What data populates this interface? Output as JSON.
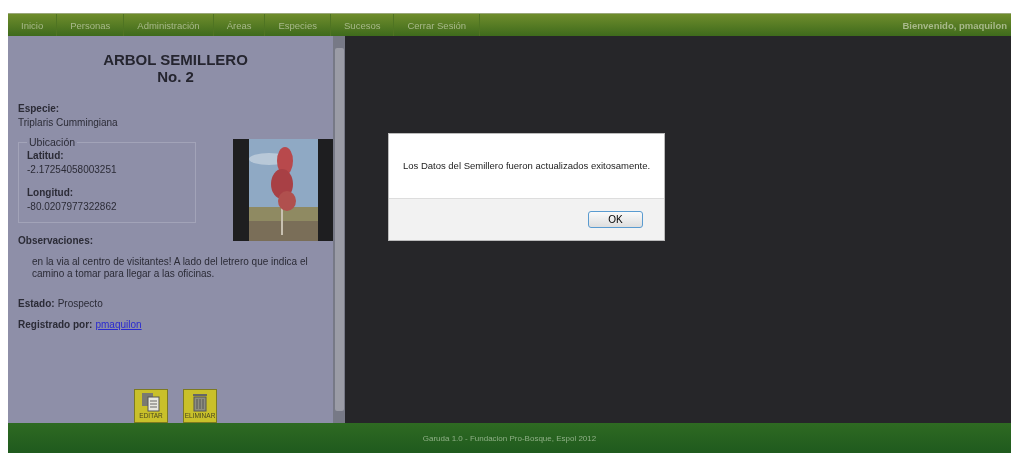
{
  "nav": {
    "items": [
      "Inicio",
      "Personas",
      "Administración",
      "Áreas",
      "Especies",
      "Sucesos",
      "Cerrar Sesión"
    ],
    "welcome": "Bienvenido, pmaquilon"
  },
  "record": {
    "title": "ARBOL SEMILLERO",
    "number": "No. 2",
    "species_label": "Especie:",
    "species": "Triplaris Cummingiana",
    "location": {
      "legend": "Ubicación",
      "lat_label": "Latitud:",
      "lat": "-2.17254058003251",
      "lon_label": "Longitud:",
      "lon": "-80.0207977322862"
    },
    "observations_label": "Observaciones:",
    "observations": "en la via al centro de visitantes! A lado del letrero que indica el camino a tomar para llegar a las oficinas.",
    "status_label": "Estado:",
    "status": "Prospecto",
    "registered_label": "Registrado por:",
    "registered_by": "pmaquilon",
    "actions": [
      {
        "kind": "edit",
        "label": "EDITAR"
      },
      {
        "kind": "delete",
        "label": "ELIMINAR"
      }
    ]
  },
  "dialog": {
    "message": "Los Datos del Semillero fueron actualizados exitosamente.",
    "button": "OK"
  },
  "footer": "Garuda 1.0 - Fundacion Pro-Bosque, Espol 2012"
}
